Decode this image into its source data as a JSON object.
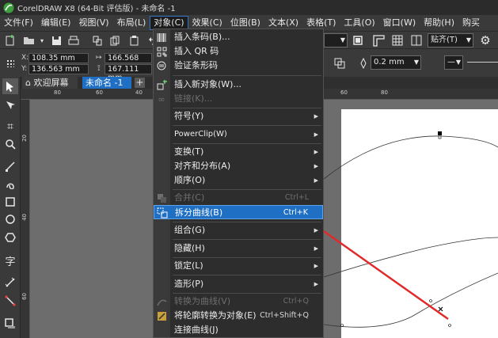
{
  "titlebar": {
    "title": "CorelDRAW X8 (64-Bit 评估版) - 未命名 -1"
  },
  "menubar": {
    "items": [
      "文件(F)",
      "编辑(E)",
      "视图(V)",
      "布局(L)",
      "对象(C)",
      "效果(C)",
      "位图(B)",
      "文本(X)",
      "表格(T)",
      "工具(O)",
      "窗口(W)",
      "帮助(H)",
      "购买"
    ]
  },
  "toolbar": {
    "align_label": "贴齐(T)",
    "x_value": "108.35 mm",
    "y_value": "136.563 mm",
    "w_value": "166.568 mm",
    "h_value": "167.111 mm",
    "outline_width": "0.2 mm",
    "x_label": "X:",
    "y_label": "Y:"
  },
  "tabs": {
    "welcome": "欢迎屏幕",
    "document": "未命名 -1"
  },
  "ruler": {
    "h_ticks": [
      "80",
      "60",
      "40",
      "60",
      "80"
    ],
    "v_ticks": [
      "20",
      "40",
      "60"
    ]
  },
  "dropdown": {
    "items": [
      {
        "icon": "barcode-icon",
        "label": "插入条码(B)..."
      },
      {
        "icon": "qr-code-icon",
        "label": "插入 QR 码"
      },
      {
        "icon": "verify-barcode-icon",
        "label": "验证条形码"
      },
      {
        "icon": "insert-object-icon",
        "label": "插入新对象(W)..."
      },
      {
        "icon": "link-icon",
        "label": "链接(K)..."
      },
      {
        "icon": "",
        "label": "符号(Y)"
      },
      {
        "icon": "",
        "label": "PowerClip(W)"
      },
      {
        "icon": "",
        "label": "变换(T)"
      },
      {
        "icon": "",
        "label": "对齐和分布(A)"
      },
      {
        "icon": "",
        "label": "顺序(O)"
      },
      {
        "icon": "combine-icon",
        "label": "合并(C)",
        "shortcut": "Ctrl+L"
      },
      {
        "icon": "break-apart-icon",
        "label": "拆分曲线(B)",
        "shortcut": "Ctrl+K"
      },
      {
        "icon": "",
        "label": "组合(G)"
      },
      {
        "icon": "",
        "label": "隐藏(H)"
      },
      {
        "icon": "",
        "label": "锁定(L)"
      },
      {
        "icon": "",
        "label": "造形(P)"
      },
      {
        "icon": "convert-curve-icon",
        "label": "转换为曲线(V)",
        "shortcut": "Ctrl+Q"
      },
      {
        "icon": "outline-to-object-icon",
        "label": "将轮廓转换为对象(E)",
        "shortcut": "Ctrl+Shift+Q"
      },
      {
        "icon": "",
        "label": "连接曲线(J)"
      }
    ]
  },
  "colors": {
    "accent": "#1f6fc5",
    "arrow": "#e02a2a"
  }
}
